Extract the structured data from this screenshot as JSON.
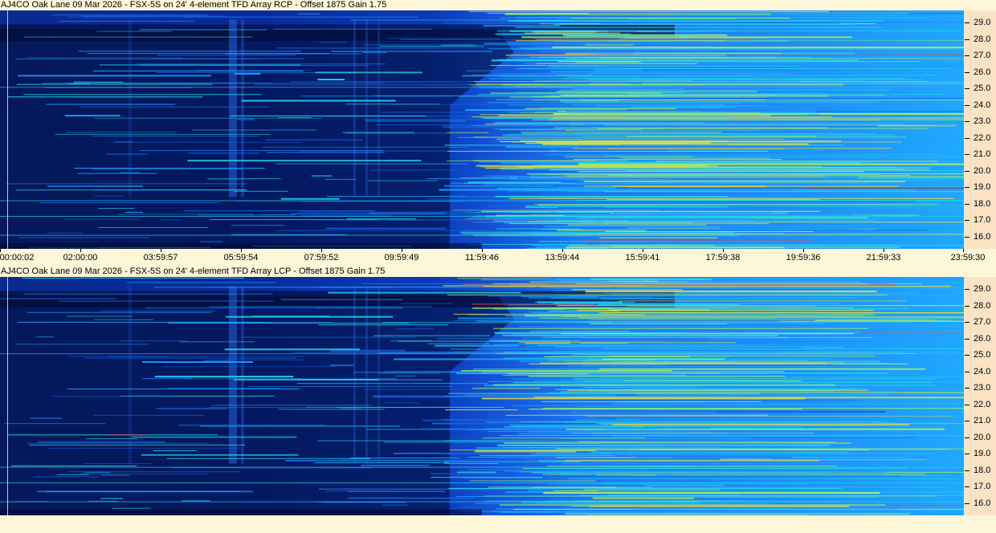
{
  "chart_data": [
    {
      "type": "heatmap",
      "title": "AJ4CO Oak Lane 09 Mar 2026 - FSX-5S on 24' 4-element TFD Array RCP  -  Offset 1875  Gain 1.75",
      "x_tick_labels": [
        "00:00:02",
        "02:00:00",
        "03:59:57",
        "05:59:54",
        "07:59:52",
        "09:59:49",
        "11:59:46",
        "13:59:44",
        "15:59:41",
        "17:59:38",
        "19:59:36",
        "21:59:33",
        "23:59:30"
      ],
      "y_tick_labels": [
        "29.0",
        "28.0",
        "27.0",
        "26.0",
        "25.0",
        "24.0",
        "23.0",
        "22.0",
        "21.0",
        "20.0",
        "19.0",
        "18.0",
        "17.0",
        "16.0"
      ],
      "xlabel": "",
      "ylabel": "",
      "ylim": [
        15.25,
        29.75
      ],
      "colormap": [
        "#000a30",
        "#0a2a8f",
        "#1565e0",
        "#1ea0ff",
        "#22d4e8",
        "#a8f060",
        "#f0e030",
        "#ff4040"
      ]
    },
    {
      "type": "heatmap",
      "title": "AJ4CO Oak Lane 09 Mar 2026 - FSX-5S on 24' 4-element TFD Array LCP  -  Offset 1875  Gain 1.75",
      "y_tick_labels": [
        "29.0",
        "28.0",
        "27.0",
        "26.0",
        "25.0",
        "24.0",
        "23.0",
        "22.0",
        "21.0",
        "20.0",
        "19.0",
        "18.0",
        "17.0",
        "16.0"
      ],
      "xlabel": "",
      "ylabel": "",
      "ylim": [
        15.25,
        29.75
      ],
      "colormap": [
        "#000a30",
        "#0a2a8f",
        "#1565e0",
        "#1ea0ff",
        "#22d4e8",
        "#a8f060",
        "#f0e030",
        "#ff4040"
      ]
    }
  ]
}
